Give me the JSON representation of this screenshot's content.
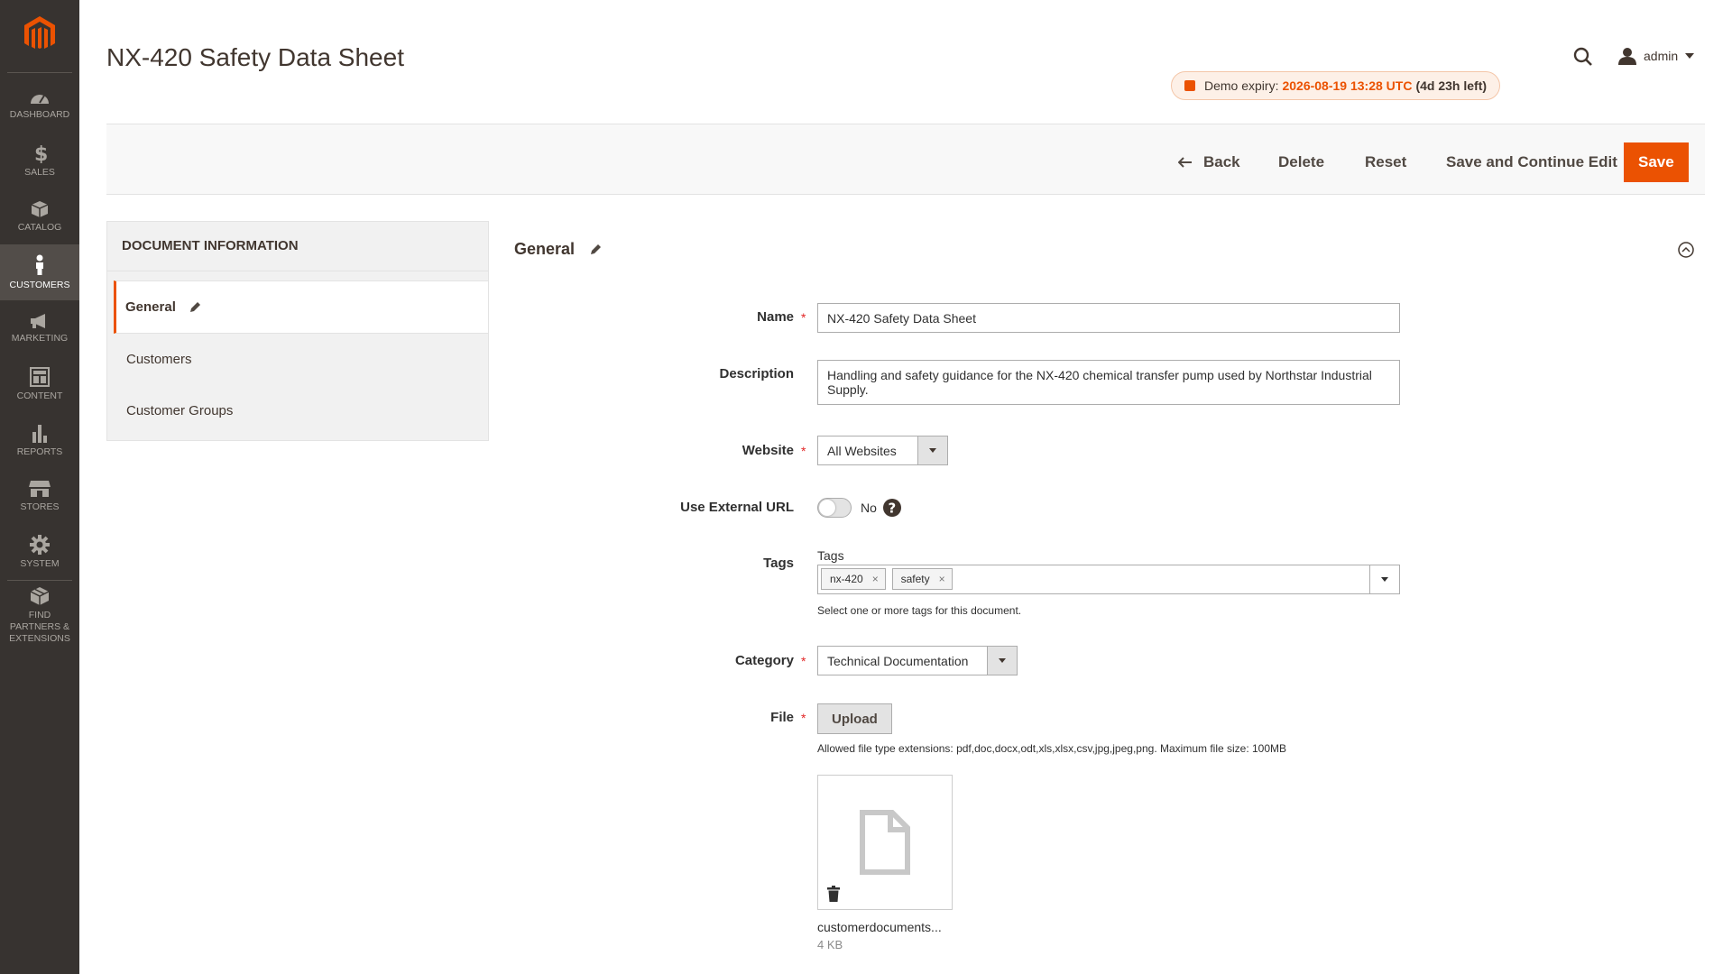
{
  "sidebar": {
    "items": [
      {
        "label": "DASHBOARD",
        "icon": "dashboard-icon"
      },
      {
        "label": "SALES",
        "icon": "dollar-icon"
      },
      {
        "label": "CATALOG",
        "icon": "cube-icon"
      },
      {
        "label": "CUSTOMERS",
        "icon": "person-icon"
      },
      {
        "label": "MARKETING",
        "icon": "megaphone-icon"
      },
      {
        "label": "CONTENT",
        "icon": "layout-icon"
      },
      {
        "label": "REPORTS",
        "icon": "bar-chart-icon"
      },
      {
        "label": "STORES",
        "icon": "storefront-icon"
      },
      {
        "label": "SYSTEM",
        "icon": "gear-icon"
      },
      {
        "label": "FIND PARTNERS & EXTENSIONS",
        "icon": "boxes-icon"
      }
    ],
    "active_index": 3
  },
  "header": {
    "title": "NX-420 Safety Data Sheet",
    "user": "admin",
    "demo_label": "Demo expiry:",
    "demo_expiry": "2026-08-19 13:28 UTC",
    "demo_left": "(4d 23h left)"
  },
  "actions": {
    "back": "Back",
    "delete": "Delete",
    "reset": "Reset",
    "save_continue": "Save and Continue Edit",
    "save": "Save"
  },
  "tabs": {
    "title": "DOCUMENT INFORMATION",
    "items": [
      "General",
      "Customers",
      "Customer Groups"
    ]
  },
  "form": {
    "section_title": "General",
    "name_label": "Name",
    "name_value": "NX-420 Safety Data Sheet",
    "description_label": "Description",
    "description_value": "Handling and safety guidance for the NX-420 chemical transfer pump used by Northstar Industrial Supply.",
    "website_label": "Website",
    "website_value": "All Websites",
    "external_url_label": "Use External URL",
    "external_url_value": "No",
    "tags_label": "Tags",
    "tags_inner_label": "Tags",
    "tags": [
      "nx-420",
      "safety"
    ],
    "tags_note": "Select one or more tags for this document.",
    "category_label": "Category",
    "category_value": "Technical Documentation",
    "file_label": "File",
    "upload_label": "Upload",
    "file_note": "Allowed file type extensions: pdf,doc,docx,odt,xls,xlsx,csv,jpg,jpeg,png. Maximum file size: 100MB",
    "file_name": "customerdocuments...",
    "file_size": "4 KB"
  },
  "colors": {
    "accent": "#eb5202",
    "sidebar_bg": "#373330",
    "sidebar_active": "#524d49"
  }
}
